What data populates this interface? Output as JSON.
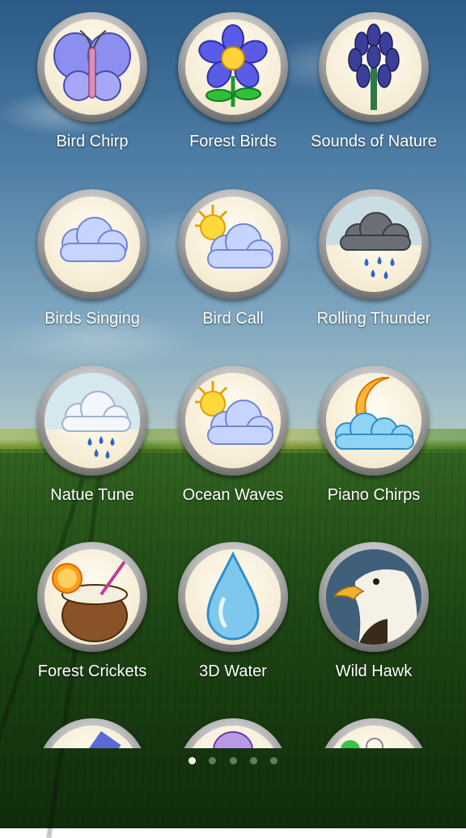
{
  "apps": [
    {
      "label": "Bird Chirp",
      "icon": "butterfly-icon"
    },
    {
      "label": "Forest Birds",
      "icon": "flower-icon"
    },
    {
      "label": "Sounds of Nature",
      "icon": "lupine-icon"
    },
    {
      "label": "Birds Singing",
      "icon": "cloud-icon"
    },
    {
      "label": "Bird Call",
      "icon": "partly-sunny-icon"
    },
    {
      "label": "Rolling Thunder",
      "icon": "rain-cloud-icon"
    },
    {
      "label": "Natue Tune",
      "icon": "light-rain-icon"
    },
    {
      "label": "Ocean Waves",
      "icon": "partly-sunny-icon"
    },
    {
      "label": "Piano Chirps",
      "icon": "moon-clouds-icon"
    },
    {
      "label": "Forest Crickets",
      "icon": "coconut-drink-icon"
    },
    {
      "label": "3D Water",
      "icon": "water-drop-icon"
    },
    {
      "label": "Wild Hawk",
      "icon": "eagle-icon"
    }
  ],
  "page_indicator": {
    "total": 5,
    "current": 1
  }
}
